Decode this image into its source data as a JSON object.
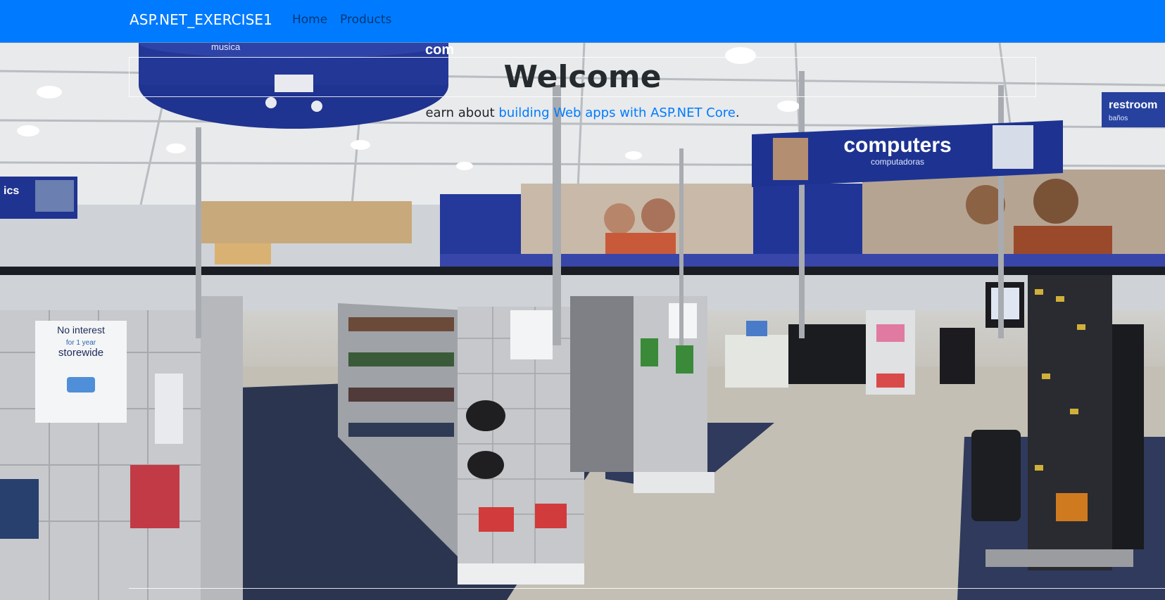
{
  "navbar": {
    "brand": "ASP.NET_EXERCISE1",
    "links": [
      {
        "label": "Home"
      },
      {
        "label": "Products"
      }
    ],
    "background_color": "#007bff"
  },
  "main": {
    "heading": "Welcome",
    "lead_prefix": "earn about ",
    "lead_link": "building Web apps with ASP.NET Core",
    "lead_suffix": ".",
    "link_color": "#007bff"
  },
  "background_photo": {
    "signs": {
      "computers_title": "computers",
      "computers_subtitle": "computadoras",
      "restroom_title": "restroom",
      "restroom_subtitle": "baños",
      "musica": "musica",
      "ics": "ics",
      "comp_partial": "com",
      "no_interest_line1": "No interest",
      "no_interest_line2": "for 1 year",
      "no_interest_line3": "storewide"
    }
  }
}
